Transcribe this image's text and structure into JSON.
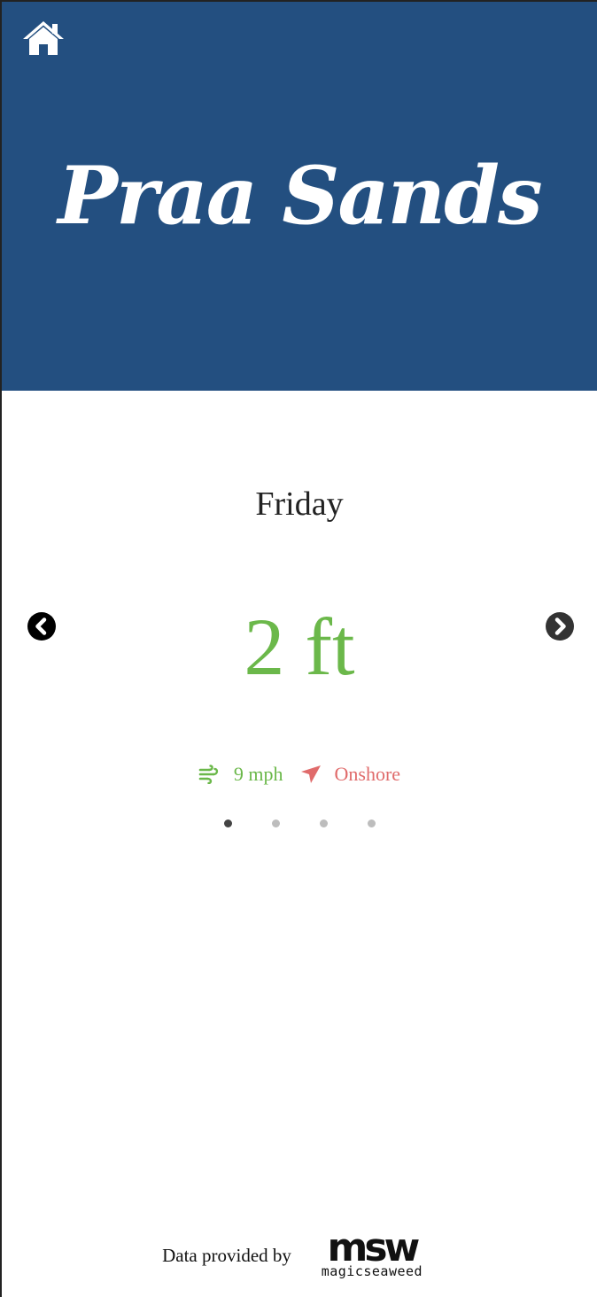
{
  "theme": {
    "header_bg": "#234f80",
    "good_color": "#6bb84a",
    "bad_color": "#e06b6b",
    "dot_active": "#444444",
    "dot_inactive": "#bdbdbd"
  },
  "header": {
    "home_icon": "home-icon",
    "title": "Praa Sands"
  },
  "forecast": {
    "day": "Friday",
    "wave_height": "2 ft",
    "wind_icon": "wind-icon",
    "wind_speed": "9 mph",
    "direction_icon": "arrow-direction-icon",
    "wind_direction": "Onshore",
    "prev_icon": "chevron-left-circle-icon",
    "next_icon": "chevron-right-circle-icon"
  },
  "pagination": {
    "count": 4,
    "active_index": 0
  },
  "footer": {
    "credit_text": "Data provided by",
    "logo_mark": "msw",
    "logo_wordmark": "magicseaweed"
  }
}
